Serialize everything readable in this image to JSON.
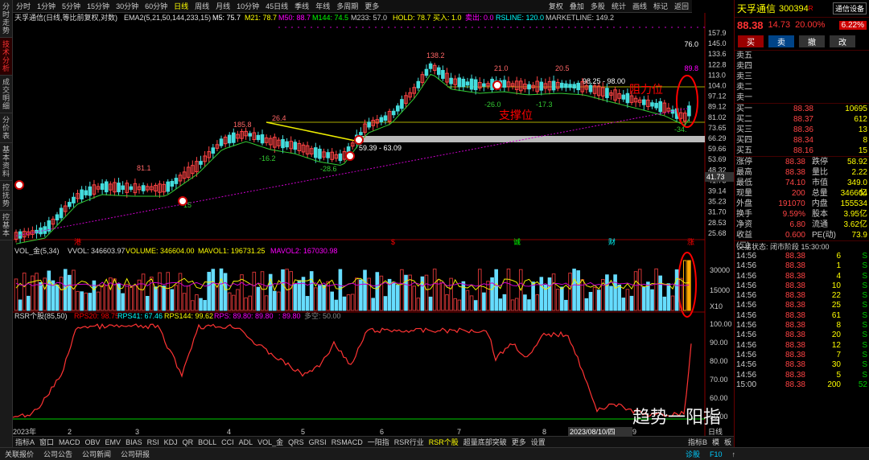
{
  "left_tabs": [
    "分时走势",
    "技术分析",
    "成交明细",
    "分价表",
    "基本资料",
    "控抚势",
    "控基本"
  ],
  "period_tabs": [
    "分时",
    "1分钟",
    "5分钟",
    "15分钟",
    "30分钟",
    "60分钟",
    "日线",
    "周线",
    "月线",
    "10分钟",
    "45日线",
    "季线",
    "年线",
    "多周期",
    "更多"
  ],
  "right_tools": [
    "复权",
    "叠加",
    "多股",
    "统计",
    "画线",
    "标记",
    "返回"
  ],
  "ind_line": {
    "name": "天孚通信(日线,等比前复权,对数)",
    "ema": "EMA2(5,21,50,144,233,15)",
    "m5": "M5: 75.7",
    "m21": "M21: 78.7",
    "m50": "M50: 88.7",
    "m144": "M144: 74.5",
    "m233": "M233: 57.0",
    "hold": "HOLD: 78.7",
    "buy": "买入: 1.0",
    "sell": "卖出: 0.0",
    "rsline": "RSLINE: 120.0",
    "mline": "MARKETLINE: 149.2"
  },
  "price_axis": [
    "157.9",
    "145.0",
    "133.6",
    "122.8",
    "113.0",
    "104.0",
    "97.12",
    "89.12",
    "81.02",
    "73.65",
    "66.29",
    "59.66",
    "53.69",
    "48.32",
    "41.73",
    "39.14",
    "35.23",
    "31.70",
    "28.53",
    "25.68"
  ],
  "price_labels": {
    "top_right": "76.0",
    "p89": "89.8",
    "p138": "138.2",
    "p81": "81.1",
    "p185": "185.8",
    "p26": "26.4",
    "p21": "21.0",
    "p205": "20.5",
    "range1": "98.25 - 98.00",
    "range2": "59.39 - 63.09",
    "m162": "-16.2",
    "m286": "-28.6",
    "m26": "-26.0",
    "m173": "-17.3",
    "m34": "-34.",
    "m15": "15",
    "current": "41.73"
  },
  "annotations": {
    "resistance": "阻力位",
    "support": "支撑位"
  },
  "x_markers": [
    "港",
    "$",
    "诚",
    "财",
    "涨"
  ],
  "vol_line": {
    "name": "VOL_金(5,34)",
    "vvol": "VVOL: 346603.97",
    "volume": "VOLUME: 346604.00",
    "mavol1": "MAVOL1: 196731.25",
    "mavol2": "MAVOL2: 167030.98"
  },
  "vol_axis": [
    "30000",
    "15000",
    "X10"
  ],
  "rsr_line": {
    "name": "RSR个股(85,50)",
    "rps20": "RPS20: 98.75",
    "rps41": "RPS41: 67.46",
    "rps144": "RPS144: 99.62",
    "rps": "RPS: 89.80",
    "rps2": ": 89.80",
    "rps3": ": 89.80",
    "dk": "多空: 50.00"
  },
  "rsr_axis": [
    "100.00",
    "90.00",
    "80.00",
    "70.00",
    "60.00",
    "50.00"
  ],
  "x_axis": [
    "2023年",
    "2",
    "3",
    "4",
    "5",
    "6",
    "7",
    "8",
    "2023/08/10/四",
    "9",
    "日线"
  ],
  "bottom_tabs": [
    "指标A",
    "窗口",
    "MACD",
    "OBV",
    "EMV",
    "BIAS",
    "RSI",
    "KDJ",
    "QR",
    "BOLL",
    "CCI",
    "ADL",
    "VOL_金",
    "QRS",
    "GRSI",
    "RSMACD",
    "一阳指",
    "RSR行业",
    "RSR个股",
    "超量底部突破",
    "更多",
    "设置"
  ],
  "bottom_right": [
    "指标B",
    "模",
    "板"
  ],
  "status_tabs": [
    "关联报价",
    "公司公告",
    "公司新闻",
    "公司研报"
  ],
  "status_right": [
    "诊股",
    "F10",
    "↑"
  ],
  "quote": {
    "name": "天孚通信",
    "code": "300394",
    "flag": "R",
    "setting": "通信设备",
    "pct_badge": "6.22%",
    "price": "88.38",
    "change": "14.73",
    "change_pct": "20.00%",
    "actions": [
      "买",
      "卖",
      "撤",
      "改"
    ],
    "sells": [
      "卖五",
      "卖四",
      "卖三",
      "卖二",
      "卖一"
    ],
    "buys": [
      {
        "l": "买一",
        "p": "88.38",
        "v": "10695"
      },
      {
        "l": "买二",
        "p": "88.37",
        "v": "612"
      },
      {
        "l": "买三",
        "p": "88.36",
        "v": "13"
      },
      {
        "l": "买四",
        "p": "88.34",
        "v": "8"
      },
      {
        "l": "买五",
        "p": "88.16",
        "v": "15"
      }
    ],
    "stats": [
      [
        "涨停",
        "88.38",
        "跌停",
        "58.92"
      ],
      [
        "最高",
        "88.38",
        "量比",
        "2.22"
      ],
      [
        "最低",
        "74.10",
        "市值",
        "349.0亿"
      ],
      [
        "现量",
        "200",
        "总量",
        "346604"
      ],
      [
        "外盘",
        "191070",
        "内盘",
        "155534"
      ],
      [
        "换手",
        "9.59%",
        "股本",
        "3.95亿"
      ],
      [
        "净资",
        "6.80",
        "流通",
        "3.62亿"
      ],
      [
        "收益(二)",
        "0.600",
        "PE(动)",
        "73.9"
      ]
    ],
    "trade_status": "交易状态: 闭市阶段 15:30:00",
    "ticks": [
      [
        "14:56",
        "88.38",
        "6",
        "S"
      ],
      [
        "14:56",
        "88.38",
        "1",
        "S"
      ],
      [
        "14:56",
        "88.38",
        "4",
        "S"
      ],
      [
        "14:56",
        "88.38",
        "10",
        "S"
      ],
      [
        "14:56",
        "88.38",
        "22",
        "S"
      ],
      [
        "14:56",
        "88.38",
        "25",
        "S"
      ],
      [
        "14:56",
        "88.38",
        "61",
        "S"
      ],
      [
        "14:56",
        "88.38",
        "8",
        "S"
      ],
      [
        "14:56",
        "88.38",
        "20",
        "S"
      ],
      [
        "14:56",
        "88.38",
        "12",
        "S"
      ],
      [
        "14:56",
        "88.38",
        "7",
        "S"
      ],
      [
        "14:56",
        "88.38",
        "30",
        "S"
      ],
      [
        "14:56",
        "88.38",
        "5",
        "S"
      ],
      [
        "15:00",
        "88.38",
        "200",
        "52"
      ]
    ]
  },
  "watermark": "趋势一阳指"
}
